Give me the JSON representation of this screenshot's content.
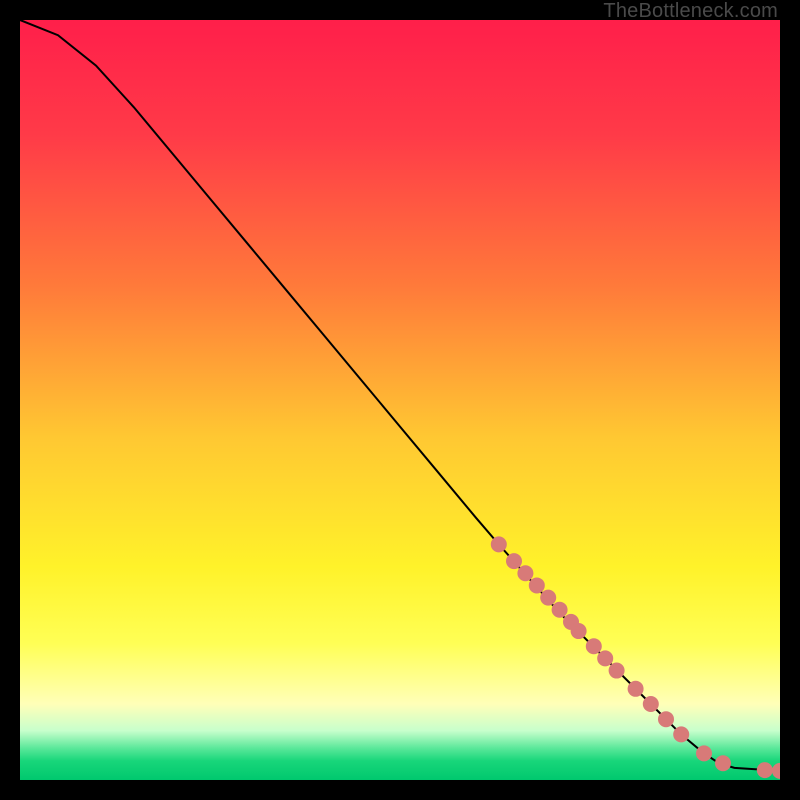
{
  "watermark": "TheBottleneck.com",
  "colors": {
    "black": "#000000",
    "curve": "#000000",
    "marker_fill": "#d87a78",
    "marker_stroke": "#b35553",
    "gradient_stops": [
      {
        "offset": 0.0,
        "color": "#ff1f4a"
      },
      {
        "offset": 0.15,
        "color": "#ff3a48"
      },
      {
        "offset": 0.35,
        "color": "#ff7a3a"
      },
      {
        "offset": 0.55,
        "color": "#ffc832"
      },
      {
        "offset": 0.72,
        "color": "#fff22a"
      },
      {
        "offset": 0.82,
        "color": "#ffff55"
      },
      {
        "offset": 0.9,
        "color": "#ffffb8"
      },
      {
        "offset": 0.935,
        "color": "#c8ffcc"
      },
      {
        "offset": 0.958,
        "color": "#5be89a"
      },
      {
        "offset": 0.975,
        "color": "#18d67a"
      },
      {
        "offset": 1.0,
        "color": "#00c86e"
      }
    ]
  },
  "chart_data": {
    "type": "line",
    "title": "",
    "xlabel": "",
    "ylabel": "",
    "xlim": [
      0,
      100
    ],
    "ylim": [
      0,
      100
    ],
    "series": [
      {
        "name": "curve",
        "x": [
          0,
          5,
          10,
          15,
          20,
          25,
          30,
          35,
          40,
          45,
          50,
          55,
          60,
          63,
          71,
          78,
          83,
          87,
          90,
          92,
          94,
          100
        ],
        "y": [
          100,
          98,
          94,
          88.5,
          82.5,
          76.5,
          70.5,
          64.5,
          58.5,
          52.5,
          46.5,
          40.5,
          34.5,
          31,
          22,
          15,
          10,
          6,
          3.5,
          2.2,
          1.6,
          1.2
        ]
      }
    ],
    "markers": {
      "name": "points",
      "x": [
        63,
        65,
        66.5,
        68,
        69.5,
        71,
        72.5,
        73.5,
        75.5,
        77,
        78.5,
        81,
        83,
        85,
        87,
        90,
        92.5,
        98,
        100
      ],
      "y": [
        31,
        28.8,
        27.2,
        25.6,
        24,
        22.4,
        20.8,
        19.6,
        17.6,
        16,
        14.4,
        12,
        10,
        8,
        6,
        3.5,
        2.2,
        1.3,
        1.2
      ]
    }
  }
}
